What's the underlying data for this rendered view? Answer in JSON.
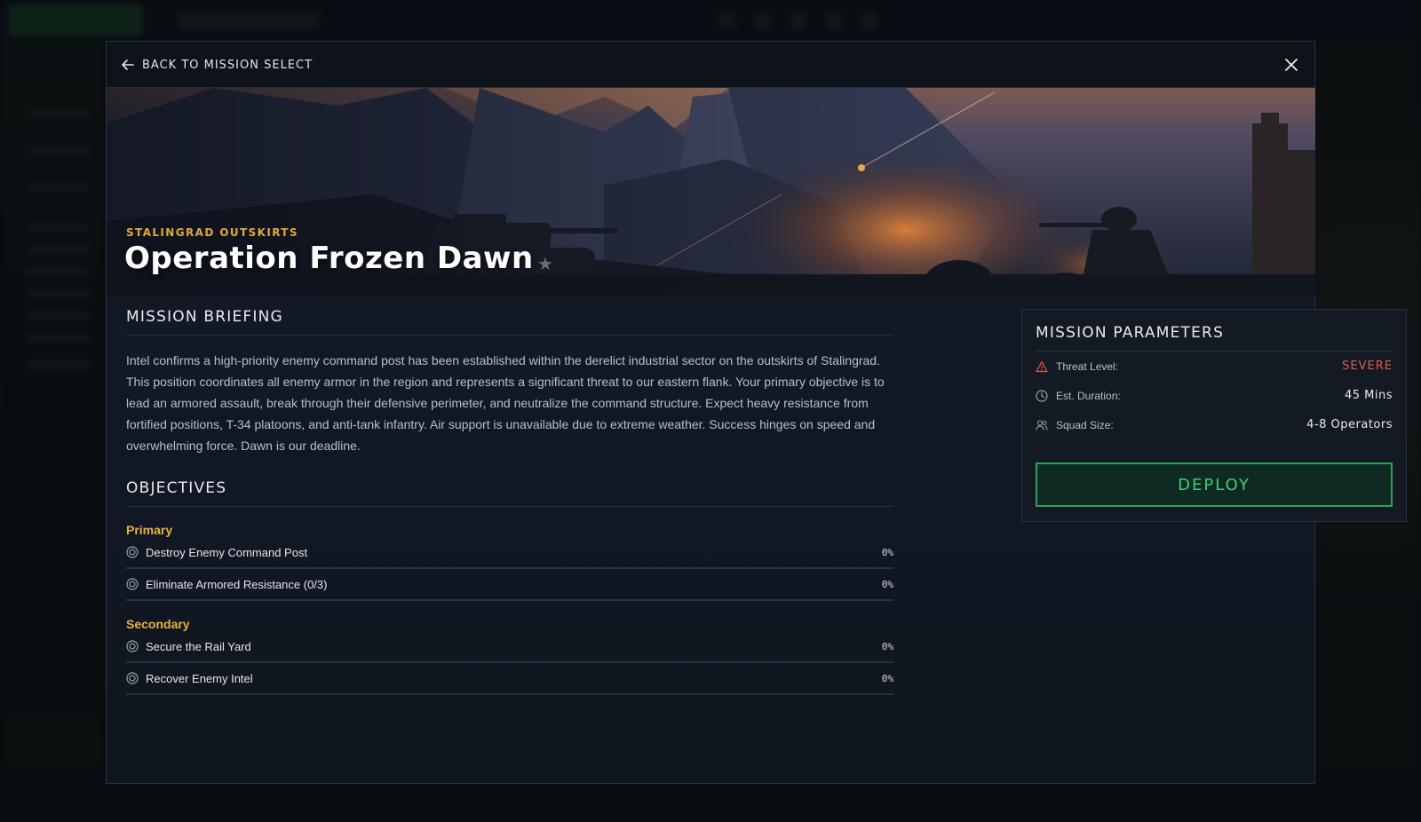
{
  "header": {
    "back_label": "BACK TO MISSION SELECT"
  },
  "hero": {
    "location": "STALINGRAD OUTSKIRTS",
    "title": "Operation Frozen Dawn"
  },
  "briefing": {
    "heading": "MISSION BRIEFING",
    "text": "Intel confirms a high-priority enemy command post has been established within the derelict industrial sector on the outskirts of Stalingrad. This position coordinates all enemy armor in the region and represents a significant threat to our eastern flank. Your primary objective is to lead an armored assault, break through their defensive perimeter, and neutralize the command structure. Expect heavy resistance from fortified positions, T-34 platoons, and anti-tank infantry. Air support is unavailable due to extreme weather. Success hinges on speed and overwhelming force. Dawn is our deadline."
  },
  "objectives": {
    "heading": "OBJECTIVES",
    "primary_label": "Primary",
    "primary": [
      {
        "label": "Destroy Enemy Command Post",
        "progress": "0%"
      },
      {
        "label": "Eliminate Armored Resistance (0/3)",
        "progress": "0%"
      }
    ],
    "secondary_label": "Secondary",
    "secondary": [
      {
        "label": "Secure the Rail Yard",
        "progress": "0%"
      },
      {
        "label": "Recover Enemy Intel",
        "progress": "0%"
      }
    ]
  },
  "parameters": {
    "heading": "MISSION PARAMETERS",
    "threat_label": "Threat Level:",
    "threat_value": "SEVERE",
    "duration_label": "Est. Duration:",
    "duration_value": "45 Mins",
    "squad_label": "Squad Size:",
    "squad_value": "4-8 Operators",
    "deploy_label": "DEPLOY"
  },
  "colors": {
    "accent_gold": "#e0a93a",
    "severe_red": "#e2574c",
    "deploy_green": "#3fce70"
  },
  "icons": [
    "arrow-left-icon",
    "close-icon",
    "target-icon",
    "warning-icon",
    "clock-icon",
    "users-icon"
  ]
}
